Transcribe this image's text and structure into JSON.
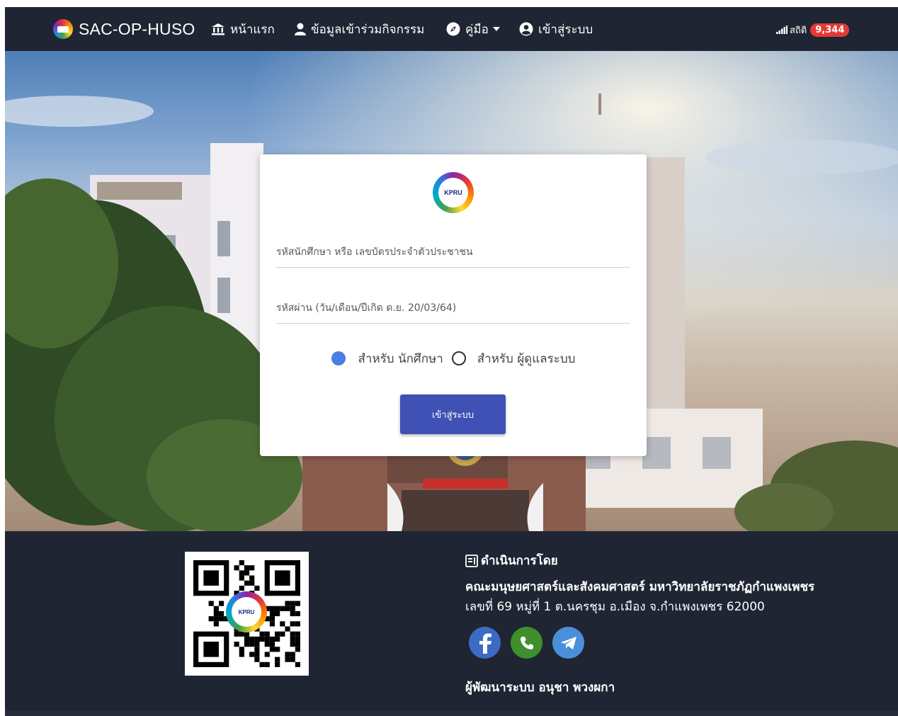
{
  "navbar": {
    "brand": "SAC-OP-HUSO",
    "items": [
      {
        "label": "หน้าแรก",
        "icon": "bank-icon"
      },
      {
        "label": "ข้อมูลเข้าร่วมกิจกรรม",
        "icon": "user-icon"
      },
      {
        "label": "คู่มือ",
        "icon": "compass-icon",
        "dropdown": true
      },
      {
        "label": "เข้าสู่ระบบ",
        "icon": "user-circle-icon"
      }
    ],
    "stats_label": "สถิติ",
    "stats_count": "9,344"
  },
  "login": {
    "logo_text": "KPRU",
    "username_placeholder": "รหัสนักศึกษา หรือ เลขบัตรประจำตัวประชาชน",
    "password_placeholder": "รหัสผ่าน (วัน/เดือน/ปีเกิด ด.ย. 20/03/64)",
    "role_student": "สำหรับ นักศึกษา",
    "role_admin": "สำหรับ ผู้ดูแลระบบ",
    "selected_role": "student",
    "submit_label": "เข้าสู่ระบบ"
  },
  "footer": {
    "qr_logo_text": "KPRU",
    "operated_by": "ดำเนินการโดย",
    "organization": "คณะมนุษยศาสตร์และสังคมศาสตร์ มหาวิทยาลัยราชภัฏกำแพงเพชร",
    "address": "เลขที่ 69 หมู่ที่ 1 ต.นครชุม อ.เมือง จ.กำแพงเพชร 62000",
    "developer": "ผู้พัฒนาระบบ อนุชา พวงผกา"
  },
  "colors": {
    "navbar_bg": "#1f2533",
    "badge": "#e53935",
    "primary_button": "#3f51b5",
    "radio_selected": "#4a7ee0"
  }
}
